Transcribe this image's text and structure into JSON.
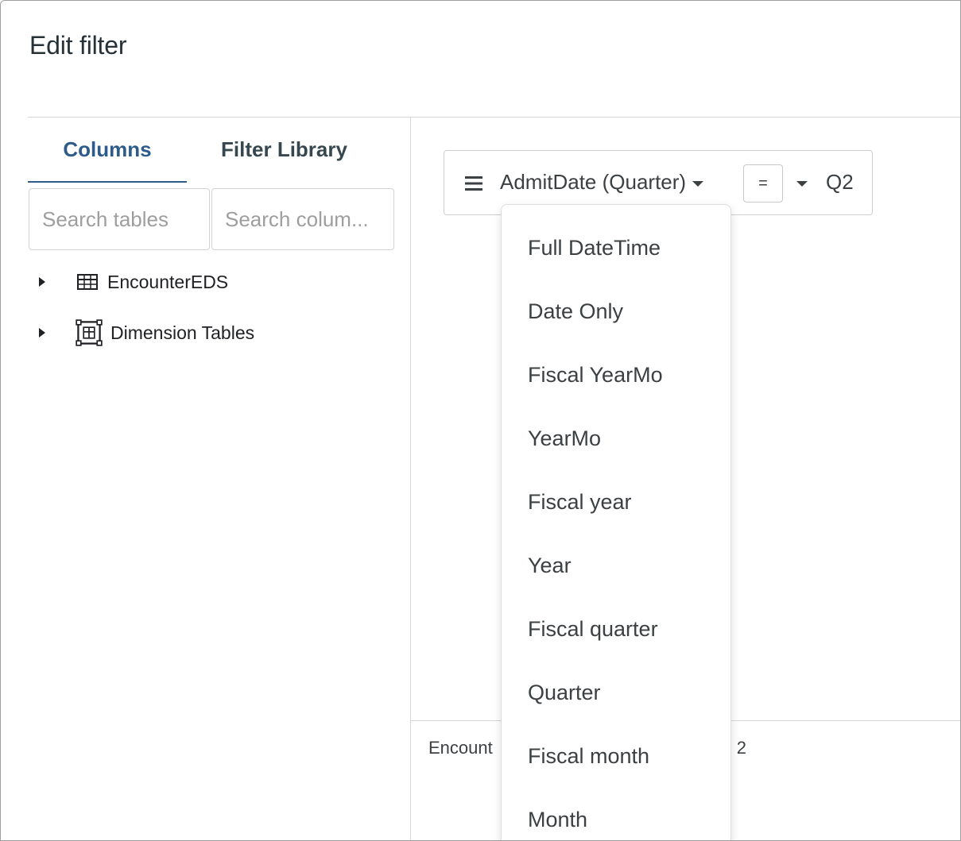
{
  "dialog": {
    "title": "Edit filter"
  },
  "left_panel": {
    "tabs": [
      {
        "label": "Columns",
        "active": true
      },
      {
        "label": "Filter Library",
        "active": false
      }
    ],
    "search_tables_placeholder": "Search tables",
    "search_columns_placeholder": "Search colum...",
    "tree": [
      {
        "label": "EncounterEDS",
        "icon": "table-icon"
      },
      {
        "label": "Dimension Tables",
        "icon": "dimension-table-icon"
      }
    ]
  },
  "filter": {
    "field": "AdmitDate (Quarter)",
    "operator": "=",
    "value": "Q2"
  },
  "summary": {
    "left_text": "Encount",
    "right_text": "= 2"
  },
  "dropdown": {
    "options": [
      "Full DateTime",
      "Date Only",
      "Fiscal YearMo",
      "YearMo",
      "Fiscal year",
      "Year",
      "Fiscal quarter",
      "Quarter",
      "Fiscal month",
      "Month"
    ]
  },
  "colors": {
    "accent": "#2d5c8a",
    "text": "#3c4043",
    "border": "#d6d6d6"
  }
}
